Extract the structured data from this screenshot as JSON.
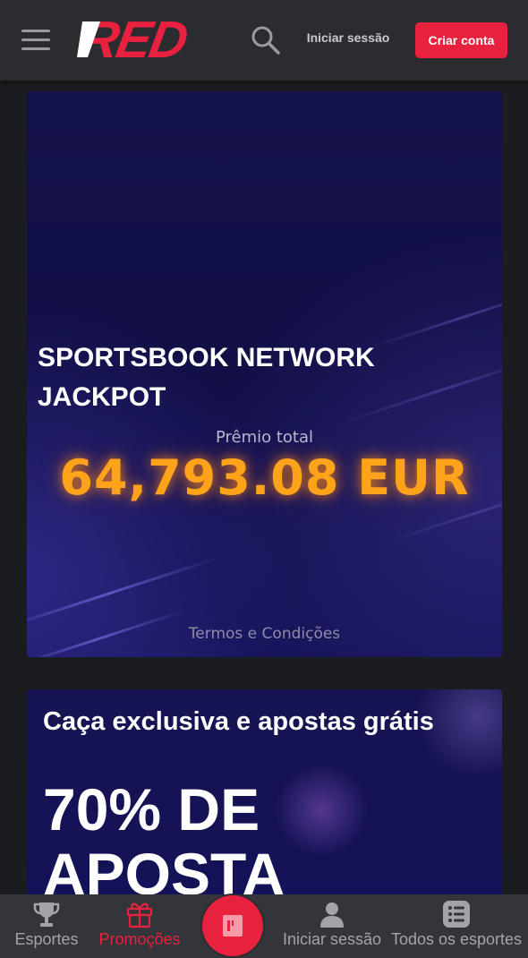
{
  "header": {
    "logo_text": "RED",
    "login_label": "Iniciar sessão",
    "signup_label": "Criar conta",
    "icons": [
      "menu-icon",
      "search-icon"
    ]
  },
  "jackpot_card": {
    "title_line1": "SPORTSBOOK NETWORK",
    "title_line2": "JACKPOT",
    "prize_label": "Prêmio total",
    "prize_amount": "64,793.08 EUR",
    "terms_label": "Termos e Condições"
  },
  "promo_card": {
    "subtitle": "Caça exclusiva e apostas grátis",
    "headline_line1": "70% DE",
    "headline_line2": "APOSTA"
  },
  "bottom_nav": {
    "items": [
      {
        "label": "Esportes",
        "icon": "trophy-icon",
        "active": false
      },
      {
        "label": "Promoções",
        "icon": "gift-icon",
        "active": true
      },
      {
        "label": "Iniciar sessão",
        "icon": "user-icon",
        "active": false
      },
      {
        "label": "Todos os esportes",
        "icon": "list-icon",
        "active": false
      }
    ],
    "center_icon": "betslip-icon"
  },
  "colors": {
    "brand_red": "#e8213f",
    "prize_orange": "#ffa31a",
    "header_bg": "#2b2c30",
    "page_bg": "#1b1c1f",
    "card_bg": "#14124a"
  }
}
